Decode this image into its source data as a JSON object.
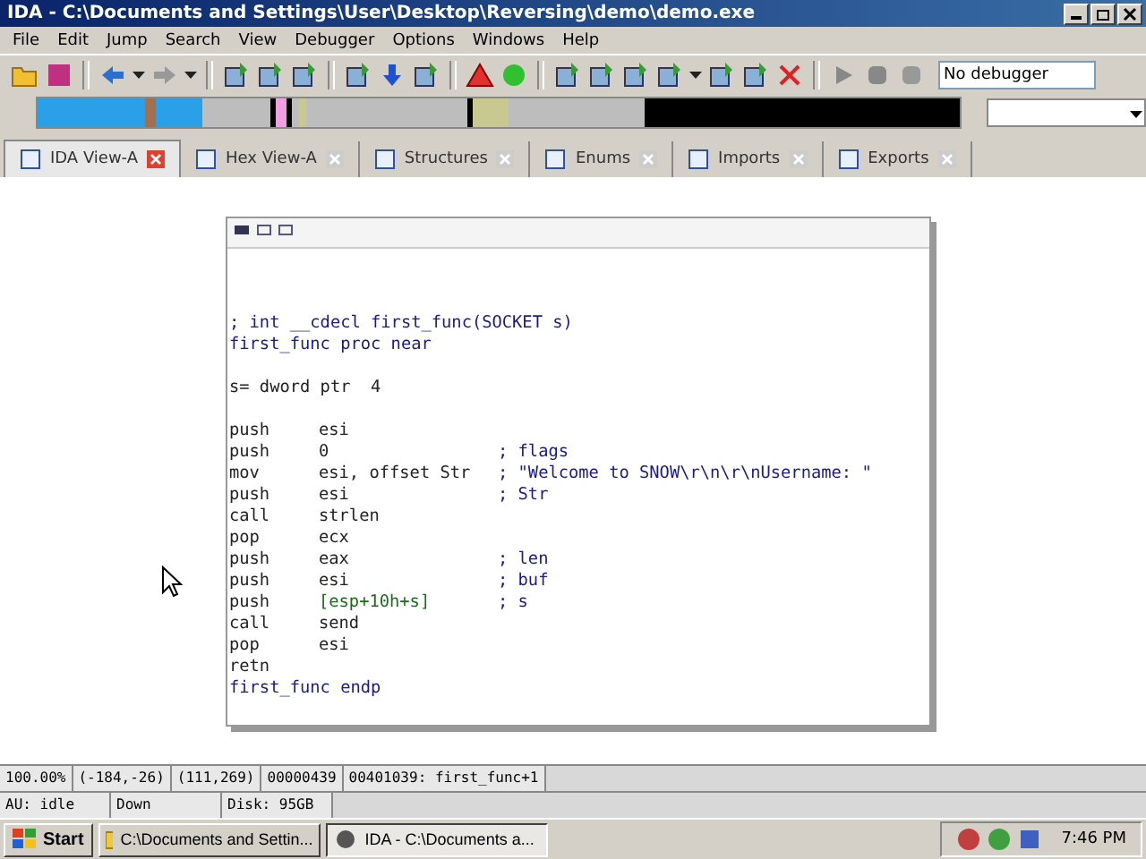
{
  "window": {
    "title": "IDA - C:\\Documents and Settings\\User\\Desktop\\Reversing\\demo\\demo.exe"
  },
  "menu": [
    "File",
    "Edit",
    "Jump",
    "Search",
    "View",
    "Debugger",
    "Options",
    "Windows",
    "Help"
  ],
  "toolbar": {
    "debugger_select": "No debugger"
  },
  "tabs": [
    {
      "label": "IDA View-A",
      "selected": true
    },
    {
      "label": "Hex View-A",
      "selected": false
    },
    {
      "label": "Structures",
      "selected": false
    },
    {
      "label": "Enums",
      "selected": false
    },
    {
      "label": "Imports",
      "selected": false
    },
    {
      "label": "Exports",
      "selected": false
    }
  ],
  "code": [
    {
      "kind": "comment",
      "text": "; int __cdecl first_func(SOCKET s)"
    },
    {
      "kind": "label",
      "text": "first_func proc near"
    },
    {
      "kind": "blank"
    },
    {
      "kind": "var",
      "text": "s= dword ptr  4"
    },
    {
      "kind": "blank"
    },
    {
      "kind": "instr",
      "op": "push",
      "arg": "esi"
    },
    {
      "kind": "instr",
      "op": "push",
      "arg": "0",
      "comment": "; flags"
    },
    {
      "kind": "instr",
      "op": "mov",
      "arg": "esi, offset Str",
      "comment": "; \"Welcome to SNOW\\r\\n\\r\\nUsername: \""
    },
    {
      "kind": "instr",
      "op": "push",
      "arg": "esi",
      "comment": "; Str"
    },
    {
      "kind": "instr",
      "op": "call",
      "arg": "strlen"
    },
    {
      "kind": "instr",
      "op": "pop",
      "arg": "ecx"
    },
    {
      "kind": "instr",
      "op": "push",
      "arg": "eax",
      "comment": "; len"
    },
    {
      "kind": "instr",
      "op": "push",
      "arg": "esi",
      "comment": "; buf"
    },
    {
      "kind": "instr",
      "op": "push",
      "arg": "[esp+10h+s]",
      "comment": "; s"
    },
    {
      "kind": "instr",
      "op": "call",
      "arg": "send"
    },
    {
      "kind": "instr",
      "op": "pop",
      "arg": "esi"
    },
    {
      "kind": "instr",
      "op": "retn"
    },
    {
      "kind": "label",
      "text": "first_func endp"
    }
  ],
  "status_bar": [
    "100.00%",
    "(-184,-26)",
    "(111,269)",
    "00000439",
    "00401039: first_func+1"
  ],
  "status_bar_2": [
    "AU:  idle",
    "Down",
    "Disk: 95GB"
  ],
  "taskbar": {
    "start": "Start",
    "items": [
      {
        "label": "C:\\Documents and Settin...",
        "selected": false
      },
      {
        "label": "IDA - C:\\Documents a...",
        "selected": true
      }
    ],
    "clock": "7:46 PM"
  }
}
